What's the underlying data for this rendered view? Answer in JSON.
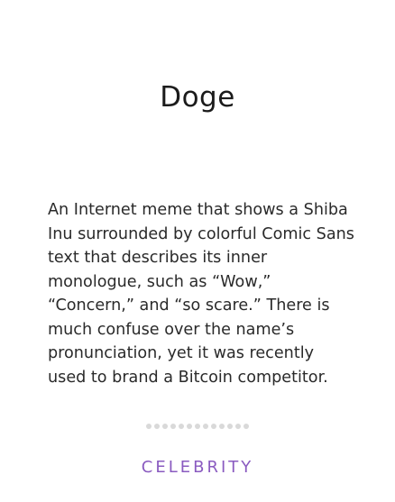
{
  "card": {
    "title": "Doge",
    "definition": "An Internet meme that shows a Shiba Inu surrounded by colorful Comic Sans text that describes its inner monologue, such as “Wow,” “Concern,” and “so scare.” There is much confuse over the name’s pronunciation, yet it was recently used to brand a Bitcoin competitor.",
    "category": "CELEBRITY",
    "category_color": "#8a5bc0",
    "dot_color": "#d9d9d9",
    "dot_count": 13
  }
}
